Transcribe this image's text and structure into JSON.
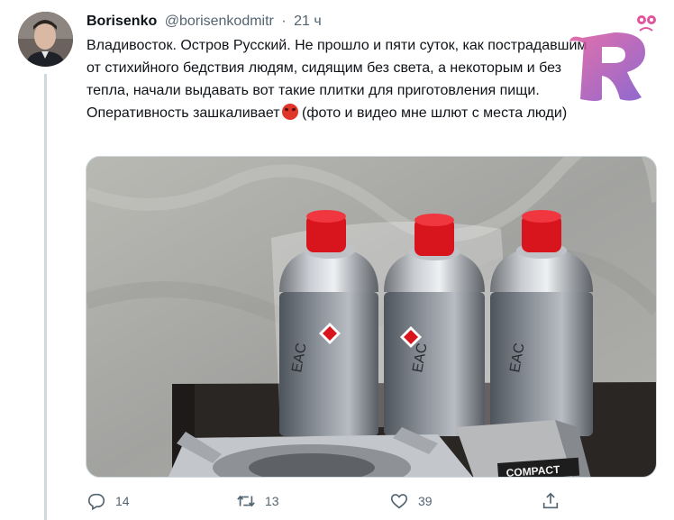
{
  "tweet": {
    "author_name": "Borisenko",
    "author_handle": "@borisenkodmitr",
    "separator": "·",
    "time": "21 ч",
    "text_main": "Владивосток. Остров Русский. Не прошло и пяти суток, как пострадавшим от стихийного бедствия людям, сидящим без света, а некоторым и без тепла, начали выдавать вот такие плитки для приготовления пищи. Оперативность зашкаливает",
    "text_tail": " (фото и видео мне шлют с места люди)",
    "emoji": "angry-face-icon"
  },
  "media": {
    "package_label": "COMPACT",
    "can_marking": "EAC"
  },
  "actions": {
    "reply_count": "14",
    "retweet_count": "13",
    "like_count": "39"
  },
  "colors": {
    "text": "#0f1419",
    "muted": "#536471",
    "cap_red": "#d8141c",
    "logo_pink": "#e0569c",
    "logo_purple": "#7a4fc7"
  }
}
